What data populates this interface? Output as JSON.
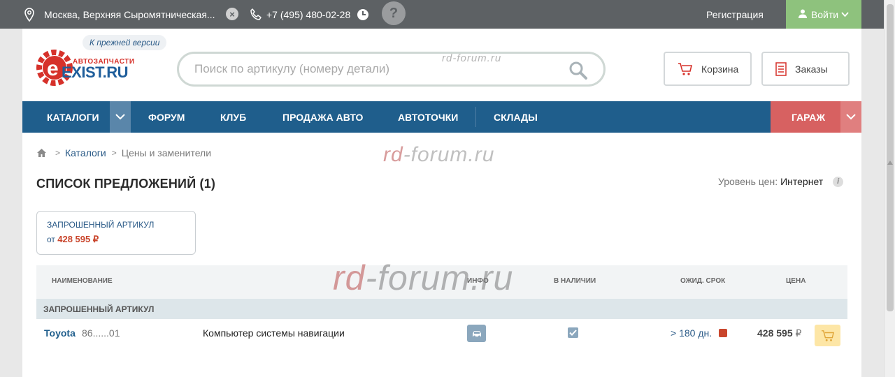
{
  "topbar": {
    "address": "Москва, Верхняя Сыромятническая...",
    "phone": "+7 (495) 480-02-28",
    "help_symbol": "?",
    "clear_symbol": "×",
    "register_label": "Регистрация",
    "login_label": "Войти"
  },
  "header": {
    "old_version_label": "К прежней версии",
    "logo_tagline": "АВТОЗАПЧАСТИ",
    "logo_brand": "EXIST.RU",
    "search_placeholder": "Поиск по артикулу (номеру детали)",
    "cart_label": "Корзина",
    "orders_label": "Заказы"
  },
  "nav": {
    "items": [
      "Каталоги",
      "Форум",
      "Клуб",
      "Продажа авто",
      "Автоточки",
      "Склады"
    ],
    "garage_label": "Гараж"
  },
  "breadcrumb": {
    "sep": ">",
    "catalogs": "Каталоги",
    "current": "Цены и заменители"
  },
  "main": {
    "title": "СПИСОК ПРЕДЛОЖЕНИЙ (1)",
    "price_level_label": "Уровень цен:",
    "price_level_value": "Интернет",
    "info_symbol": "i",
    "requested_box": {
      "heading": "Запрошенный артикул",
      "from_label": "от",
      "price": "428 595 ₽"
    }
  },
  "table": {
    "columns": [
      "Наименование",
      "Инфо",
      "В наличии",
      "Ожид. срок",
      "Цена"
    ],
    "group_label": "Запрошенный артикул",
    "rows": [
      {
        "brand": "Toyota",
        "code": "86......01",
        "name": "Компьютер системы навигации",
        "term": "> 180 дн.",
        "price": "428 595",
        "currency": "₽"
      }
    ]
  },
  "watermarks": {
    "small_prefix": "rd-forum.ru",
    "big_a": "rd",
    "big_b": "-forum.ru"
  },
  "colors": {
    "topbar": "#5d6164",
    "nav": "#1f5e8c",
    "login": "#8ec27d",
    "garage": "#d76161",
    "price_accent": "#c9452c"
  },
  "icons": {
    "pin": "map-pin-icon",
    "phone": "phone-icon",
    "clock": "clock-icon",
    "user": "user-icon",
    "search": "search-icon",
    "cart": "cart-icon",
    "orders": "orders-list-icon",
    "home": "home-icon",
    "car": "car-icon",
    "check": "checkbox-checked-icon"
  }
}
